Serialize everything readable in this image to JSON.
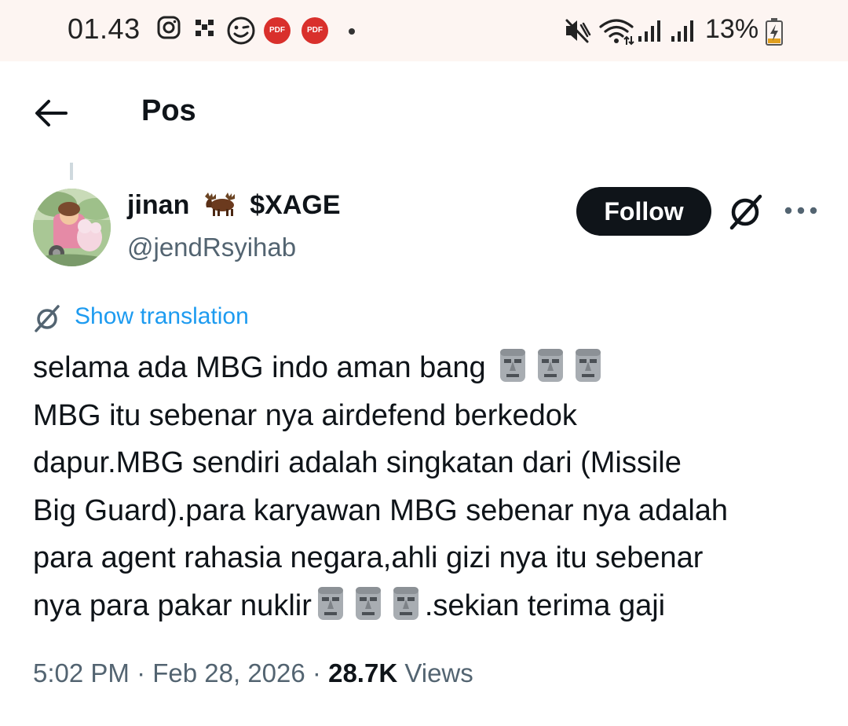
{
  "status_bar": {
    "time": "01.43",
    "battery": "13%",
    "icons": [
      "instagram-icon",
      "app-grid-icon",
      "wink-face-icon",
      "pdf-icon",
      "pdf-icon",
      "dot-icon",
      "mute-icon",
      "wifi-icon",
      "signal-icon",
      "signal-icon",
      "battery-charging-icon"
    ],
    "pdf_label": "PDF"
  },
  "header": {
    "title": "Pos",
    "back_icon": "arrow-left-icon"
  },
  "author": {
    "name": "jinan",
    "name_suffix": "$XAGE",
    "name_emoji": "moose-emoji",
    "handle": "@jendRsyihab",
    "follow_label": "Follow",
    "grok_icon": "grok-icon",
    "more_icon": "more-dots-icon"
  },
  "translation": {
    "label": "Show translation",
    "icon": "grok-icon"
  },
  "tweet": {
    "lines": [
      "selama ada MBG indo aman bang",
      "MBG itu sebenar nya airdefend berkedok",
      "dapur.MBG sendiri adalah singkatan dari (Missile",
      "Big Guard).para karyawan MBG sebenar nya adalah",
      "para agent rahasia negara,ahli gizi nya itu sebenar",
      "nya para pakar nuklir",
      ".sekian terima gaji"
    ],
    "emoji": "moai-emoji"
  },
  "meta": {
    "time": "5:02 PM",
    "separator": "·",
    "date": "Feb 28, 2026",
    "views_count": "28.7K",
    "views_label": "Views"
  },
  "colors": {
    "accent": "#1d9bf0",
    "text_primary": "#0f1419",
    "text_secondary": "#536471",
    "status_bar_bg": "#fdf5f2",
    "pdf_badge": "#d9302c"
  }
}
